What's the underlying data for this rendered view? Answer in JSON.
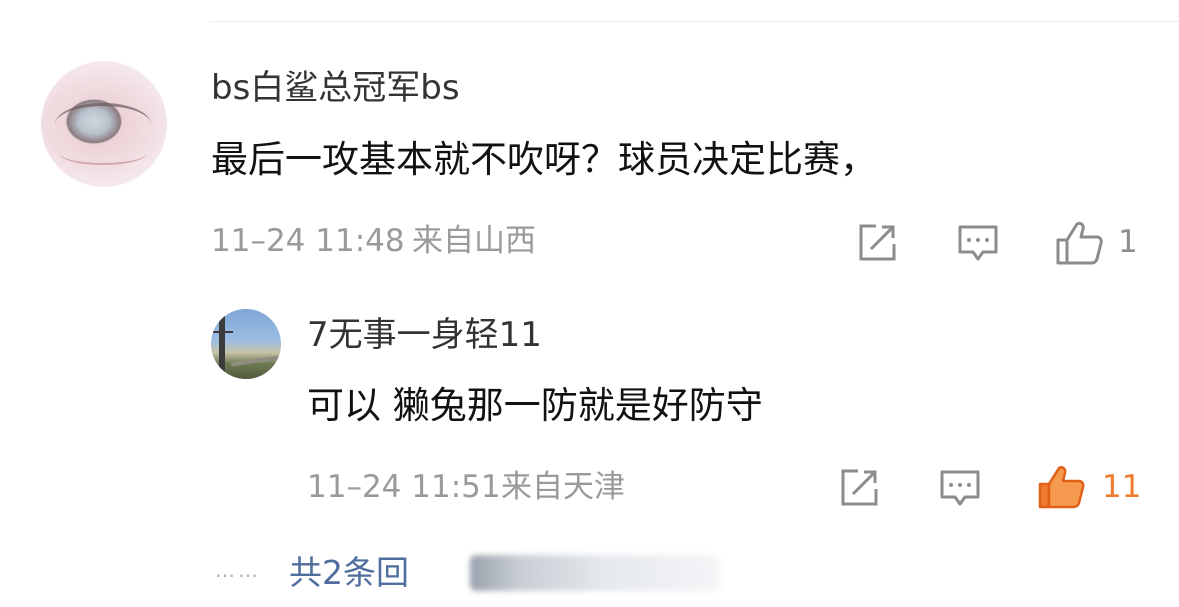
{
  "comment": {
    "username": "bs白鲨总冠军bs",
    "text": "最后一攻基本就不吹呀？球员决定比赛，",
    "time": "11–24 11:48",
    "location": "来自山西",
    "like_count": "1"
  },
  "reply": {
    "username": "7无事一身轻11",
    "text": "可以 獭兔那一防就是好防守",
    "time": "11–24 11:51",
    "location": "来自天津",
    "like_count": "11",
    "like_color": "#f07a2d"
  },
  "more_replies": {
    "dots": "……",
    "label": "共2条回"
  },
  "icons": {
    "share": "share-icon",
    "comment": "comment-icon",
    "like": "thumbs-up-icon"
  },
  "colors": {
    "link": "#4f6e9e",
    "meta": "#9a9a9a"
  }
}
